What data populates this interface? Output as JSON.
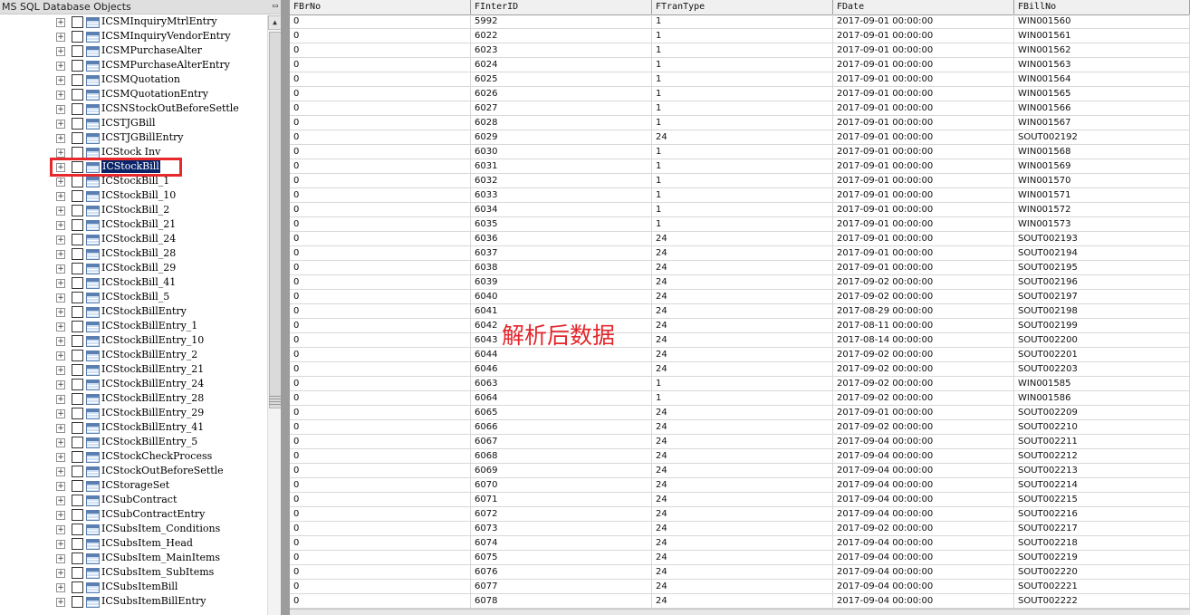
{
  "left_panel": {
    "title": "MS SQL Database Objects",
    "pin_icon": "pin-icon",
    "tree_items": [
      "ICSMInquiryMtrlEntry",
      "ICSMInquiryVendorEntry",
      "ICSMPurchaseAlter",
      "ICSMPurchaseAlterEntry",
      "ICSMQuotation",
      "ICSMQuotationEntry",
      "ICSNStockOutBeforeSettle",
      "ICSTJGBill",
      "ICSTJGBillEntry",
      "ICStock Inv",
      "ICStockBill",
      "ICStockBill_1",
      "ICStockBill_10",
      "ICStockBill_2",
      "ICStockBill_21",
      "ICStockBill_24",
      "ICStockBill_28",
      "ICStockBill_29",
      "ICStockBill_41",
      "ICStockBill_5",
      "ICStockBillEntry",
      "ICStockBillEntry_1",
      "ICStockBillEntry_10",
      "ICStockBillEntry_2",
      "ICStockBillEntry_21",
      "ICStockBillEntry_24",
      "ICStockBillEntry_28",
      "ICStockBillEntry_29",
      "ICStockBillEntry_41",
      "ICStockBillEntry_5",
      "ICStockCheckProcess",
      "ICStockOutBeforeSettle",
      "ICStorageSet",
      "ICSubContract",
      "ICSubContractEntry",
      "ICSubsItem_Conditions",
      "ICSubsItem_Head",
      "ICSubsItem_MainItems",
      "ICSubsItem_SubItems",
      "ICSubsItemBill",
      "ICSubsItemBillEntry"
    ],
    "selected_item": "ICStockBill",
    "expand_glyph": "+"
  },
  "grid": {
    "columns": [
      "FBrNo",
      "FInterID",
      "FTranType",
      "FDate",
      "FBillNo"
    ],
    "rows": [
      [
        "0",
        "5992",
        "1",
        "2017-09-01 00:00:00",
        "WIN001560"
      ],
      [
        "0",
        "6022",
        "1",
        "2017-09-01 00:00:00",
        "WIN001561"
      ],
      [
        "0",
        "6023",
        "1",
        "2017-09-01 00:00:00",
        "WIN001562"
      ],
      [
        "0",
        "6024",
        "1",
        "2017-09-01 00:00:00",
        "WIN001563"
      ],
      [
        "0",
        "6025",
        "1",
        "2017-09-01 00:00:00",
        "WIN001564"
      ],
      [
        "0",
        "6026",
        "1",
        "2017-09-01 00:00:00",
        "WIN001565"
      ],
      [
        "0",
        "6027",
        "1",
        "2017-09-01 00:00:00",
        "WIN001566"
      ],
      [
        "0",
        "6028",
        "1",
        "2017-09-01 00:00:00",
        "WIN001567"
      ],
      [
        "0",
        "6029",
        "24",
        "2017-09-01 00:00:00",
        "SOUT002192"
      ],
      [
        "0",
        "6030",
        "1",
        "2017-09-01 00:00:00",
        "WIN001568"
      ],
      [
        "0",
        "6031",
        "1",
        "2017-09-01 00:00:00",
        "WIN001569"
      ],
      [
        "0",
        "6032",
        "1",
        "2017-09-01 00:00:00",
        "WIN001570"
      ],
      [
        "0",
        "6033",
        "1",
        "2017-09-01 00:00:00",
        "WIN001571"
      ],
      [
        "0",
        "6034",
        "1",
        "2017-09-01 00:00:00",
        "WIN001572"
      ],
      [
        "0",
        "6035",
        "1",
        "2017-09-01 00:00:00",
        "WIN001573"
      ],
      [
        "0",
        "6036",
        "24",
        "2017-09-01 00:00:00",
        "SOUT002193"
      ],
      [
        "0",
        "6037",
        "24",
        "2017-09-01 00:00:00",
        "SOUT002194"
      ],
      [
        "0",
        "6038",
        "24",
        "2017-09-01 00:00:00",
        "SOUT002195"
      ],
      [
        "0",
        "6039",
        "24",
        "2017-09-02 00:00:00",
        "SOUT002196"
      ],
      [
        "0",
        "6040",
        "24",
        "2017-09-02 00:00:00",
        "SOUT002197"
      ],
      [
        "0",
        "6041",
        "24",
        "2017-08-29 00:00:00",
        "SOUT002198"
      ],
      [
        "0",
        "6042",
        "24",
        "2017-08-11 00:00:00",
        "SOUT002199"
      ],
      [
        "0",
        "6043",
        "24",
        "2017-08-14 00:00:00",
        "SOUT002200"
      ],
      [
        "0",
        "6044",
        "24",
        "2017-09-02 00:00:00",
        "SOUT002201"
      ],
      [
        "0",
        "6046",
        "24",
        "2017-09-02 00:00:00",
        "SOUT002203"
      ],
      [
        "0",
        "6063",
        "1",
        "2017-09-02 00:00:00",
        "WIN001585"
      ],
      [
        "0",
        "6064",
        "1",
        "2017-09-02 00:00:00",
        "WIN001586"
      ],
      [
        "0",
        "6065",
        "24",
        "2017-09-01 00:00:00",
        "SOUT002209"
      ],
      [
        "0",
        "6066",
        "24",
        "2017-09-02 00:00:00",
        "SOUT002210"
      ],
      [
        "0",
        "6067",
        "24",
        "2017-09-04 00:00:00",
        "SOUT002211"
      ],
      [
        "0",
        "6068",
        "24",
        "2017-09-04 00:00:00",
        "SOUT002212"
      ],
      [
        "0",
        "6069",
        "24",
        "2017-09-04 00:00:00",
        "SOUT002213"
      ],
      [
        "0",
        "6070",
        "24",
        "2017-09-04 00:00:00",
        "SOUT002214"
      ],
      [
        "0",
        "6071",
        "24",
        "2017-09-04 00:00:00",
        "SOUT002215"
      ],
      [
        "0",
        "6072",
        "24",
        "2017-09-04 00:00:00",
        "SOUT002216"
      ],
      [
        "0",
        "6073",
        "24",
        "2017-09-02 00:00:00",
        "SOUT002217"
      ],
      [
        "0",
        "6074",
        "24",
        "2017-09-04 00:00:00",
        "SOUT002218"
      ],
      [
        "0",
        "6075",
        "24",
        "2017-09-04 00:00:00",
        "SOUT002219"
      ],
      [
        "0",
        "6076",
        "24",
        "2017-09-04 00:00:00",
        "SOUT002220"
      ],
      [
        "0",
        "6077",
        "24",
        "2017-09-04 00:00:00",
        "SOUT002221"
      ],
      [
        "0",
        "6078",
        "24",
        "2017-09-04 00:00:00",
        "SOUT002222"
      ]
    ]
  },
  "annotation": {
    "text": "解析后数据",
    "color": "#e3262b"
  },
  "highlight_color": "#e8292c"
}
